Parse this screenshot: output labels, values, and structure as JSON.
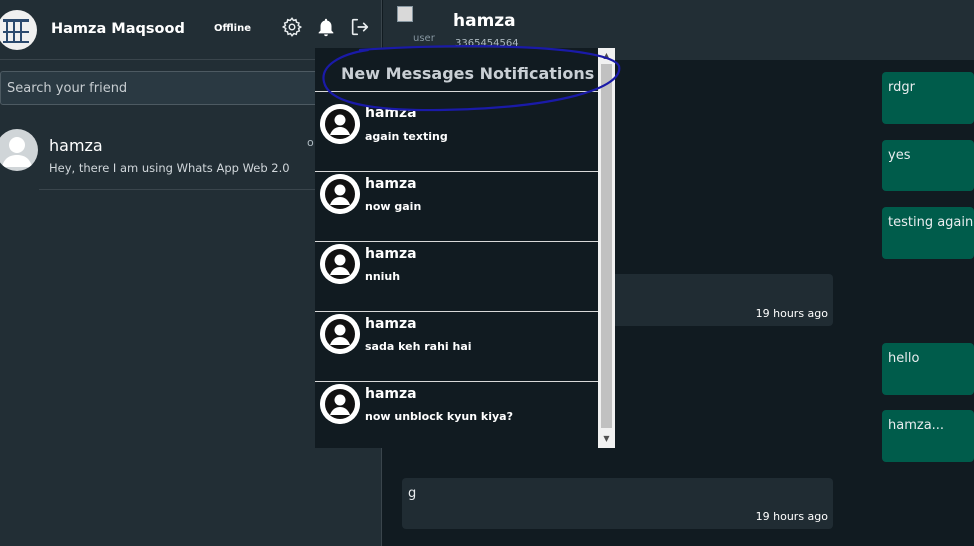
{
  "sidebar": {
    "user_name": "Hamza Maqsood",
    "status": "Offline",
    "search_placeholder": "Search your friend",
    "chats": [
      {
        "name": "hamza",
        "preview": "Hey, there I am using Whats App Web 2.0",
        "time": "o"
      }
    ]
  },
  "chat_header": {
    "contact_name": "hamza",
    "phone": "3365454564",
    "broken_image_alt": "user"
  },
  "messages": [
    {
      "direction": "out",
      "text": "rdgr"
    },
    {
      "direction": "out",
      "text": "yes"
    },
    {
      "direction": "out",
      "text": "testing again"
    },
    {
      "direction": "in",
      "text": "",
      "time": "19 hours ago"
    },
    {
      "direction": "out",
      "text": "hello"
    },
    {
      "direction": "out",
      "text": "hamza..."
    },
    {
      "direction": "in",
      "text": "g",
      "time": "19 hours ago"
    }
  ],
  "notifications": {
    "title": "New Messages Notifications",
    "items": [
      {
        "name": "hamza",
        "text": "again texting"
      },
      {
        "name": "hamza",
        "text": "now gain"
      },
      {
        "name": "hamza",
        "text": "nniuh"
      },
      {
        "name": "hamza",
        "text": "sada keh rahi hai"
      },
      {
        "name": "hamza",
        "text": "now unblock kyun kiya?"
      }
    ]
  },
  "colors": {
    "outgoing_bubble": "#005c4b",
    "incoming_bubble": "#202c33",
    "annotation": "#1a1aa8"
  },
  "icons": [
    "settings-gear-icon",
    "bell-icon",
    "logout-icon",
    "user-avatar-icon"
  ]
}
